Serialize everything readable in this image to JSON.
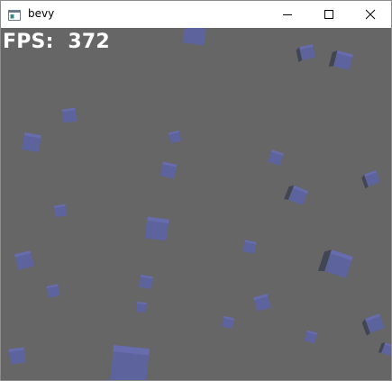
{
  "window": {
    "title": "bevy",
    "controls": {
      "minimize": "minimize-icon",
      "maximize": "maximize-icon",
      "close": "close-icon"
    }
  },
  "hud": {
    "fps_label": "FPS:",
    "fps_value": "372"
  },
  "scene": {
    "background_color": "#666666",
    "cube_color": "#5c63a6"
  }
}
